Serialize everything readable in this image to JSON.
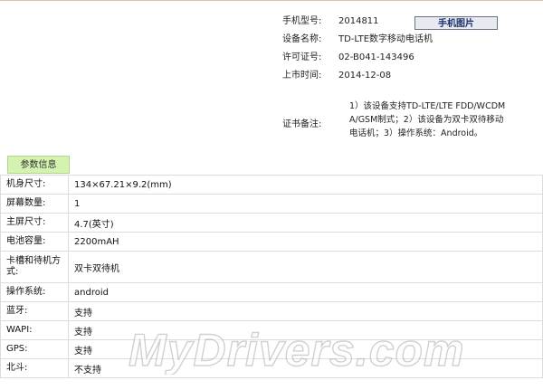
{
  "device": {
    "model_label": "手机型号:",
    "model_value": "2014811",
    "photo_button": "手机图片",
    "name_label": "设备名称:",
    "name_value": "TD-LTE数字移动电话机",
    "license_label": "许可证号:",
    "license_value": "02-B041-143496",
    "launch_label": "上市时间:",
    "launch_value": "2014-12-08",
    "remark_label": "证书备注:",
    "remark_value": "1）该设备支持TD-LTE/LTE FDD/WCDMA/GSM制式；2）该设备为双卡双待移动电话机；3）操作系统：Android。"
  },
  "params": {
    "section_title": "参数信息",
    "rows": [
      {
        "key": "机身尺寸:",
        "value": "134×67.21×9.2(mm)"
      },
      {
        "key": "屏幕数量:",
        "value": "1"
      },
      {
        "key": "主屏尺寸:",
        "value": "4.7(英寸)"
      },
      {
        "key": "电池容量:",
        "value": "2200mAH"
      },
      {
        "key": "卡槽和待机方式:",
        "value": "双卡双待机"
      },
      {
        "key": "操作系统:",
        "value": "android"
      },
      {
        "key": "蓝牙:",
        "value": "支持"
      },
      {
        "key": "WAPI:",
        "value": "支持"
      },
      {
        "key": "GPS:",
        "value": "支持"
      },
      {
        "key": "北斗:",
        "value": "不支持"
      }
    ]
  },
  "watermark": {
    "text": "MyDrivers.com"
  }
}
